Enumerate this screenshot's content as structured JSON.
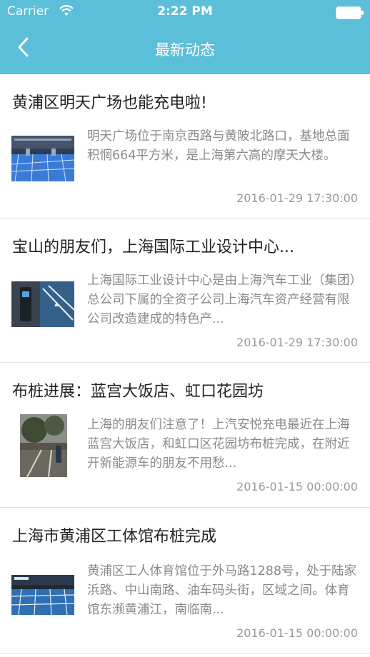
{
  "status_bar": {
    "carrier": "Carrier",
    "time": "2:22 PM"
  },
  "nav": {
    "title": "最新动态",
    "back_icon": "chevron-left-icon"
  },
  "colors": {
    "header": "#5bbfd9",
    "title_text": "#222222",
    "summary_text": "#8a8a8a",
    "date_text": "#9a9a9a"
  },
  "news": [
    {
      "title": "黄浦区明天广场也能充电啦!",
      "summary": "明天广场位于南京西路与黄陂北路口，基地总面积惘664平方米，是上海第六高的摩天大楼。",
      "date": "2016-01-29 17:30:00"
    },
    {
      "title": "宝山的朋友们，上海国际工业设计中心...",
      "summary": "上海国际工业设计中心是由上海汽车工业（集团）总公司下属的全资子公司上海汽车资产经营有限公司改造建成的特色产...",
      "date": "2016-01-29 17:30:00"
    },
    {
      "title": "布桩进展：蓝宫大饭店、虹口花园坊",
      "summary": "上海的朋友们注意了！上汽安悦充电最近在上海蓝宫大饭店，和虹口区花园坊布桩完成，在附近开新能源车的朋友不用愁...",
      "date": "2016-01-15 00:00:00"
    },
    {
      "title": "上海市黄浦区工体馆布桩完成",
      "summary": "黄浦区工人体育馆位于外马路1288号，处于陆家浜路、中山南路、油车码头街，区域之间。体育馆东濒黄浦江，南临南...",
      "date": "2016-01-15 00:00:00"
    }
  ]
}
